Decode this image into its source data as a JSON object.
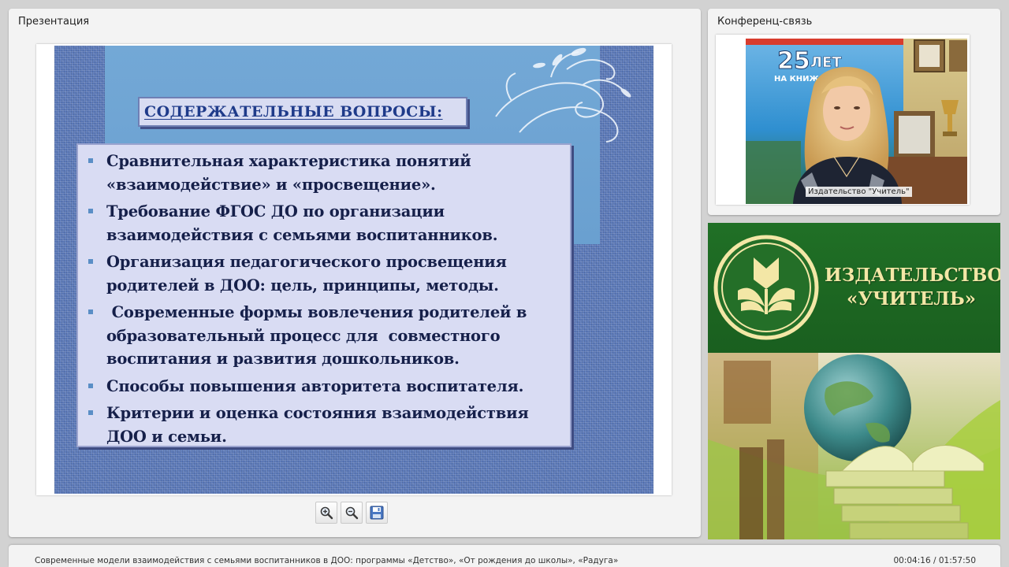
{
  "presentation_panel": {
    "title": "Презентация"
  },
  "slide": {
    "heading": "СОДЕРЖАТЕЛЬНЫЕ ВОПРОСЫ:",
    "bullets": [
      "Сравнительная характеристика понятий «взаимодействие» и «просвещение».",
      "Требование ФГОС ДО по организации взаимодействия с семьями  воспитанников.",
      "Организация педагогического просвещения родителей в ДОО: цель, принципы, методы.",
      " Современные формы вовлечения родителей в образовательный процесс для  совместного воспитания и развития дошкольников.",
      "Способы повышения авторитета воспитателя.",
      "Критерии и оценка состояния взаимодействия ДОО и семьи."
    ]
  },
  "toolbar": {
    "zoom_in_icon": "zoom-in-icon",
    "zoom_out_icon": "zoom-out-icon",
    "save_icon": "save-icon"
  },
  "conference_panel": {
    "title": "Конференц-связь",
    "video_caption": "Издательство \"Учитель\"",
    "poster_number": "25",
    "poster_word": "ЛЕТ",
    "poster_sub": "НА КНИЖ"
  },
  "banner": {
    "publisher_line1": "ИЗДАТЕЛЬСТВО",
    "publisher_line2": "«УЧИТЕЛЬ»"
  },
  "bottom_bar": {
    "title": "Современные модели взаимодействия с семьями воспитанников в ДОО: программы «Детство», «От рождения до школы», «Радуга»",
    "time": "00:04:16 / 01:57:50"
  },
  "colors": {
    "slide_blue": "#5a78b8",
    "header_band": "#73a8d6",
    "heading_text": "#1f3b8a",
    "banner_green": "#1e6a23",
    "banner_gold": "#f3e7a6"
  }
}
